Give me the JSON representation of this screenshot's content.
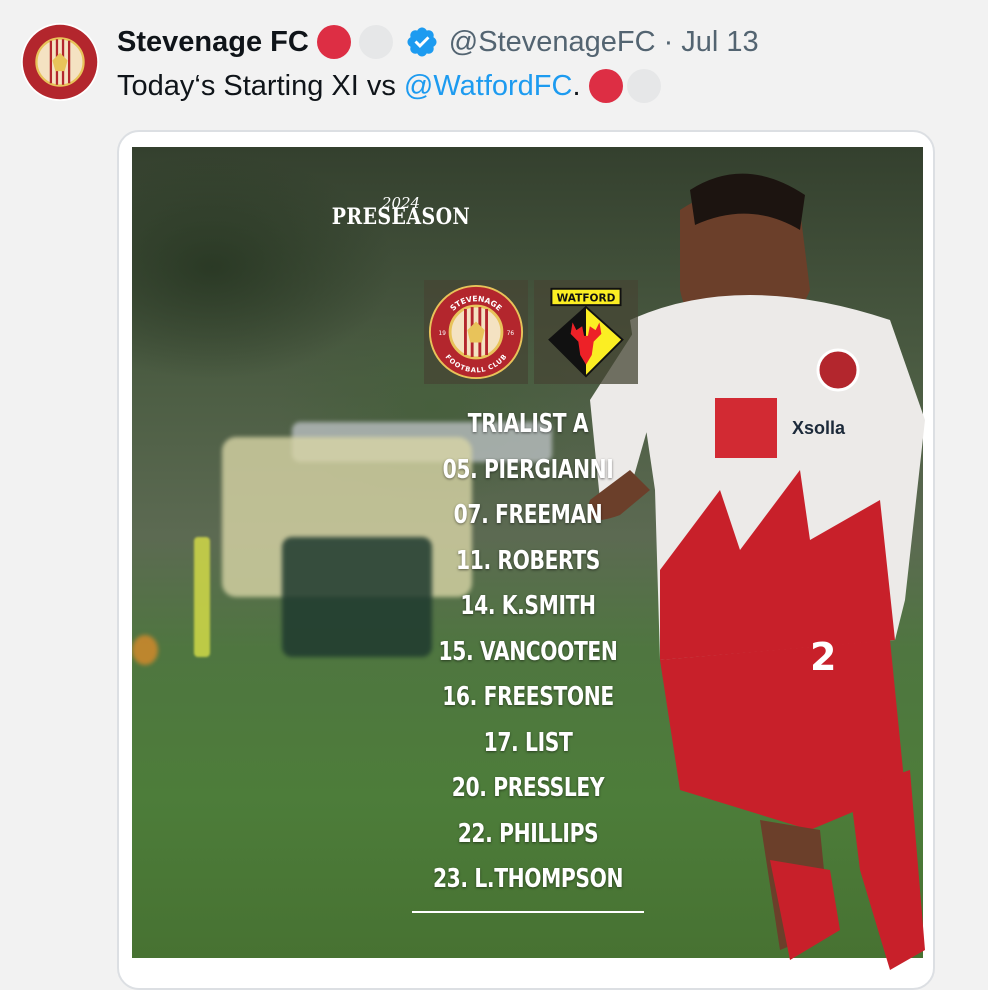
{
  "tweet": {
    "author_name": "Stevenage FC",
    "handle": "@StevenageFC",
    "separator": "·",
    "date": "Jul 13",
    "text_before": "Today‘s Starting XI vs ",
    "mention": "@WatfordFC",
    "text_after": ".",
    "accent_color": "#1d9bf0"
  },
  "graphic": {
    "season_year": "2024",
    "season_title": "PRESEASON",
    "home_badge": {
      "top_text": "STEVENAGE",
      "bottom_text": "FOOTBALL CLUB",
      "left_num": "19",
      "right_num": "76",
      "colors": {
        "primary": "#b3262d",
        "secondary": "#e8c35a"
      }
    },
    "away_badge": {
      "banner": "WATFORD",
      "colors": {
        "primary": "#fbee23",
        "secondary": "#ed2127"
      }
    },
    "lineup": [
      "TRIALIST A",
      "05. PIERGIANNI",
      "07. FREEMAN",
      "11. ROBERTS",
      "14. K.SMITH",
      "15. VANCOOTEN",
      "16. FREESTONE",
      "17. LIST",
      "20. PRESSLEY",
      "22. PHILLIPS",
      "23. L.THOMPSON"
    ],
    "sponsor": "Xsolla",
    "shirt_number": "2"
  }
}
